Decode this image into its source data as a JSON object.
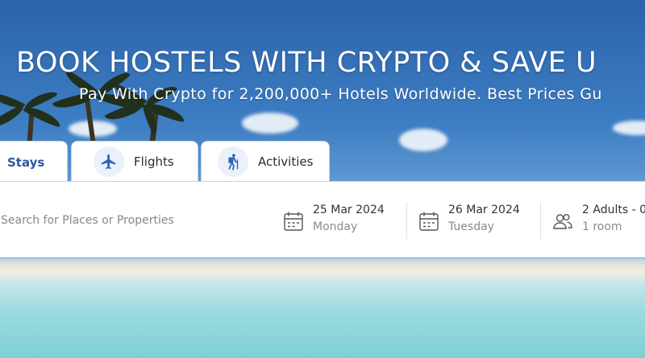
{
  "hero": {
    "title": "BOOK HOSTELS WITH CRYPTO & SAVE U",
    "subtitle": "Pay With Crypto for 2,200,000+ Hotels Worldwide. Best Prices Gu"
  },
  "tabs": [
    {
      "label": "Stays",
      "active": true
    },
    {
      "label": "Flights",
      "icon": "airplane-icon"
    },
    {
      "label": "Activities",
      "icon": "hiker-icon"
    }
  ],
  "search": {
    "placeholder": "Search for Places or Properties",
    "checkin": {
      "date": "25 Mar 2024",
      "day": "Monday",
      "icon": "calendar-icon"
    },
    "checkout": {
      "date": "26 Mar 2024",
      "day": "Tuesday",
      "icon": "calendar-icon"
    },
    "guests": {
      "summary": "2 Adults - 0",
      "rooms": "1 room",
      "icon": "users-icon"
    }
  },
  "colors": {
    "accent": "#2a58a0",
    "tab_icon_bg": "#eaf1fb"
  }
}
